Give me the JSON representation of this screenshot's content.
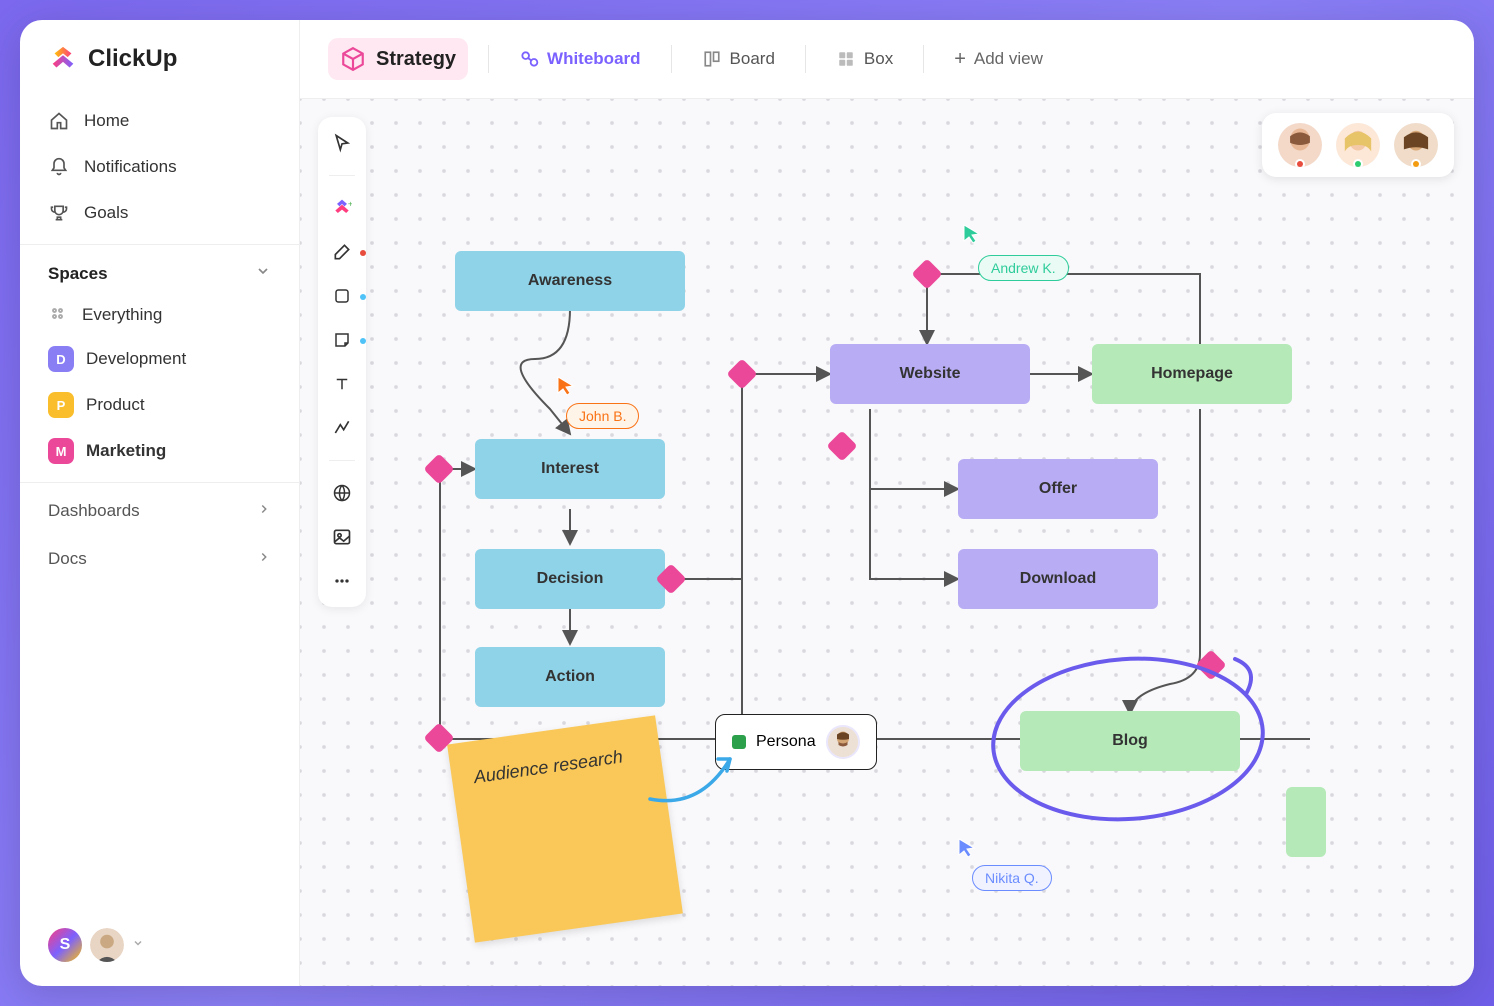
{
  "brand": "ClickUp",
  "nav": {
    "home": "Home",
    "notifications": "Notifications",
    "goals": "Goals"
  },
  "spaces": {
    "header": "Spaces",
    "everything": "Everything",
    "items": [
      {
        "letter": "D",
        "label": "Development",
        "color": "#8A7EF5"
      },
      {
        "letter": "P",
        "label": "Product",
        "color": "#FABE2C"
      },
      {
        "letter": "M",
        "label": "Marketing",
        "color": "#EC4899"
      }
    ]
  },
  "sections": {
    "dashboards": "Dashboards",
    "docs": "Docs"
  },
  "topbar": {
    "title": "Strategy",
    "views": {
      "whiteboard": "Whiteboard",
      "board": "Board",
      "box": "Box"
    },
    "add_view": "Add view"
  },
  "canvas": {
    "nodes": {
      "awareness": "Awareness",
      "interest": "Interest",
      "decision": "Decision",
      "action": "Action",
      "website": "Website",
      "homepage": "Homepage",
      "offer": "Offer",
      "download": "Download",
      "blog": "Blog",
      "persona": "Persona"
    },
    "sticky": "Audience research",
    "users": {
      "john": "John B.",
      "andrew": "Andrew K.",
      "nikita": "Nikita Q."
    },
    "collab_status": [
      "#E74C3C",
      "#2ECC71",
      "#F39C12"
    ]
  }
}
